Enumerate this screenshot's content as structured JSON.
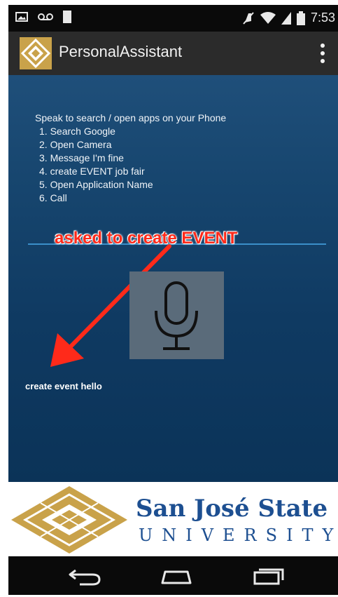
{
  "status_bar": {
    "time": "7:53",
    "icons": [
      "image-icon",
      "voicemail-icon",
      "sim-icon",
      "mute-icon",
      "wifi-icon",
      "signal-icon",
      "battery-icon"
    ]
  },
  "action_bar": {
    "title": "PersonalAssistant",
    "overflow_icon": "more-vert-icon"
  },
  "instructions": {
    "heading": "Speak to search / open apps on your Phone",
    "items": [
      "1. Search Google",
      "2. Open Camera",
      "3. Message I'm fine",
      "4. create EVENT job fair",
      "5. Open Application Name",
      "6. Call"
    ]
  },
  "annotation": {
    "text": "asked to create EVENT",
    "color": "#ff2a1a"
  },
  "mic": {
    "icon": "microphone-icon"
  },
  "result": {
    "text": "create event hello"
  },
  "footer": {
    "name": "San José State",
    "subtitle": "UNIVERSITY",
    "brand_color": "#1d4f91",
    "seal_color": "#c9a24a"
  },
  "nav_bar": {
    "buttons": [
      "back-icon",
      "home-icon",
      "recents-icon"
    ]
  }
}
